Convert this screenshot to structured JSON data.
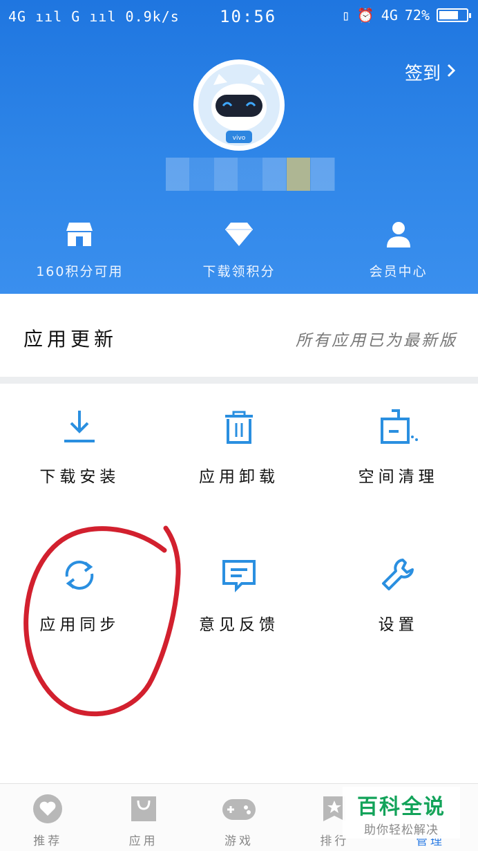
{
  "status_bar": {
    "left": "4G ııl G ııl 0.9k/s",
    "time": "10:56",
    "network": "4G",
    "battery": "72%",
    "battery_level": 0.72
  },
  "header": {
    "signin_label": "签到",
    "stats": [
      {
        "icon": "shop-icon",
        "label": "160积分可用"
      },
      {
        "icon": "diamond-icon",
        "label": "下载领积分"
      },
      {
        "icon": "user-icon",
        "label": "会员中心"
      }
    ]
  },
  "update": {
    "title": "应用更新",
    "status": "所有应用已为最新版"
  },
  "grid": [
    {
      "icon": "download-icon",
      "label": "下载安装"
    },
    {
      "icon": "trash-icon",
      "label": "应用卸载"
    },
    {
      "icon": "broom-icon",
      "label": "空间清理"
    },
    {
      "icon": "sync-icon",
      "label": "应用同步"
    },
    {
      "icon": "feedback-icon",
      "label": "意见反馈"
    },
    {
      "icon": "wrench-icon",
      "label": "设置"
    }
  ],
  "tabs": [
    {
      "icon": "heart-icon",
      "label": "推荐"
    },
    {
      "icon": "bag-icon",
      "label": "应用"
    },
    {
      "icon": "gamepad-icon",
      "label": "游戏"
    },
    {
      "icon": "rank-icon",
      "label": "排行"
    },
    {
      "icon": "manage-icon",
      "label": "管理"
    }
  ],
  "watermark": {
    "title": "百科全说",
    "subtitle": "助你轻松解决"
  },
  "colors": {
    "header_blue": "#2f86e8",
    "icon_blue": "#2a8fe0",
    "annotation_red": "#d2202e",
    "watermark_green": "#13a35a"
  }
}
